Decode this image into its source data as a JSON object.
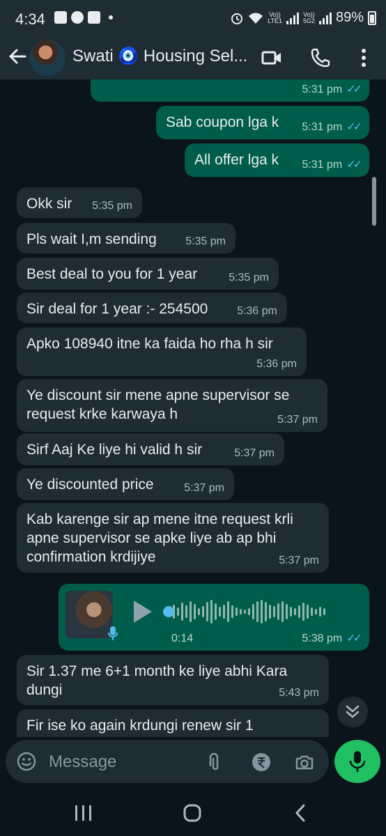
{
  "status_bar": {
    "time": "4:34",
    "battery": "89%",
    "lte_top": "Vo))",
    "lte_bottom": "LTE1",
    "g5_top": "Vo))",
    "g5_bottom": "5G2"
  },
  "header": {
    "contact": "Swati 🧿 Housing Sel..."
  },
  "messages": [
    {
      "dir": "out",
      "text": "Sab coupon lga k",
      "time": "5:31 pm"
    },
    {
      "dir": "out",
      "text": "All offer lga k",
      "time": "5:31 pm"
    },
    {
      "dir": "in",
      "text": "Okk sir",
      "time": "5:35 pm"
    },
    {
      "dir": "in",
      "text": "Pls wait I,m sending",
      "time": "5:35 pm"
    },
    {
      "dir": "in",
      "text": "Best deal to you for 1 year",
      "time": "5:35 pm"
    },
    {
      "dir": "in",
      "text": "Sir deal for 1 year :- 254500",
      "time": "5:36 pm"
    },
    {
      "dir": "in",
      "text": "Apko 108940 itne ka faida ho rha h sir",
      "time": "5:36 pm"
    },
    {
      "dir": "in",
      "text": "Ye discount sir mene apne supervisor se request krke karwaya h",
      "time": "5:37 pm"
    },
    {
      "dir": "in",
      "text": "Sirf Aaj Ke liye hi valid h sir",
      "time": "5:37 pm"
    },
    {
      "dir": "in",
      "text": "Ye discounted price",
      "time": "5:37 pm"
    },
    {
      "dir": "in",
      "text": "Kab karenge sir ap mene itne request krli apne supervisor se apke liye ab ap bhi confirmation krdijiye",
      "time": "5:37 pm"
    },
    {
      "dir": "in",
      "text": "Sir 1.37 me 6+1 month ke liye abhi Kara dungi",
      "time": "5:43 pm"
    },
    {
      "dir": "in",
      "text": "Fir ise ko again krdungi renew sir 1",
      "time": ""
    }
  ],
  "top_partial_time": "5:31 pm",
  "voice_note": {
    "duration": "0:14",
    "time": "5:38 pm"
  },
  "input": {
    "placeholder": "Message"
  }
}
